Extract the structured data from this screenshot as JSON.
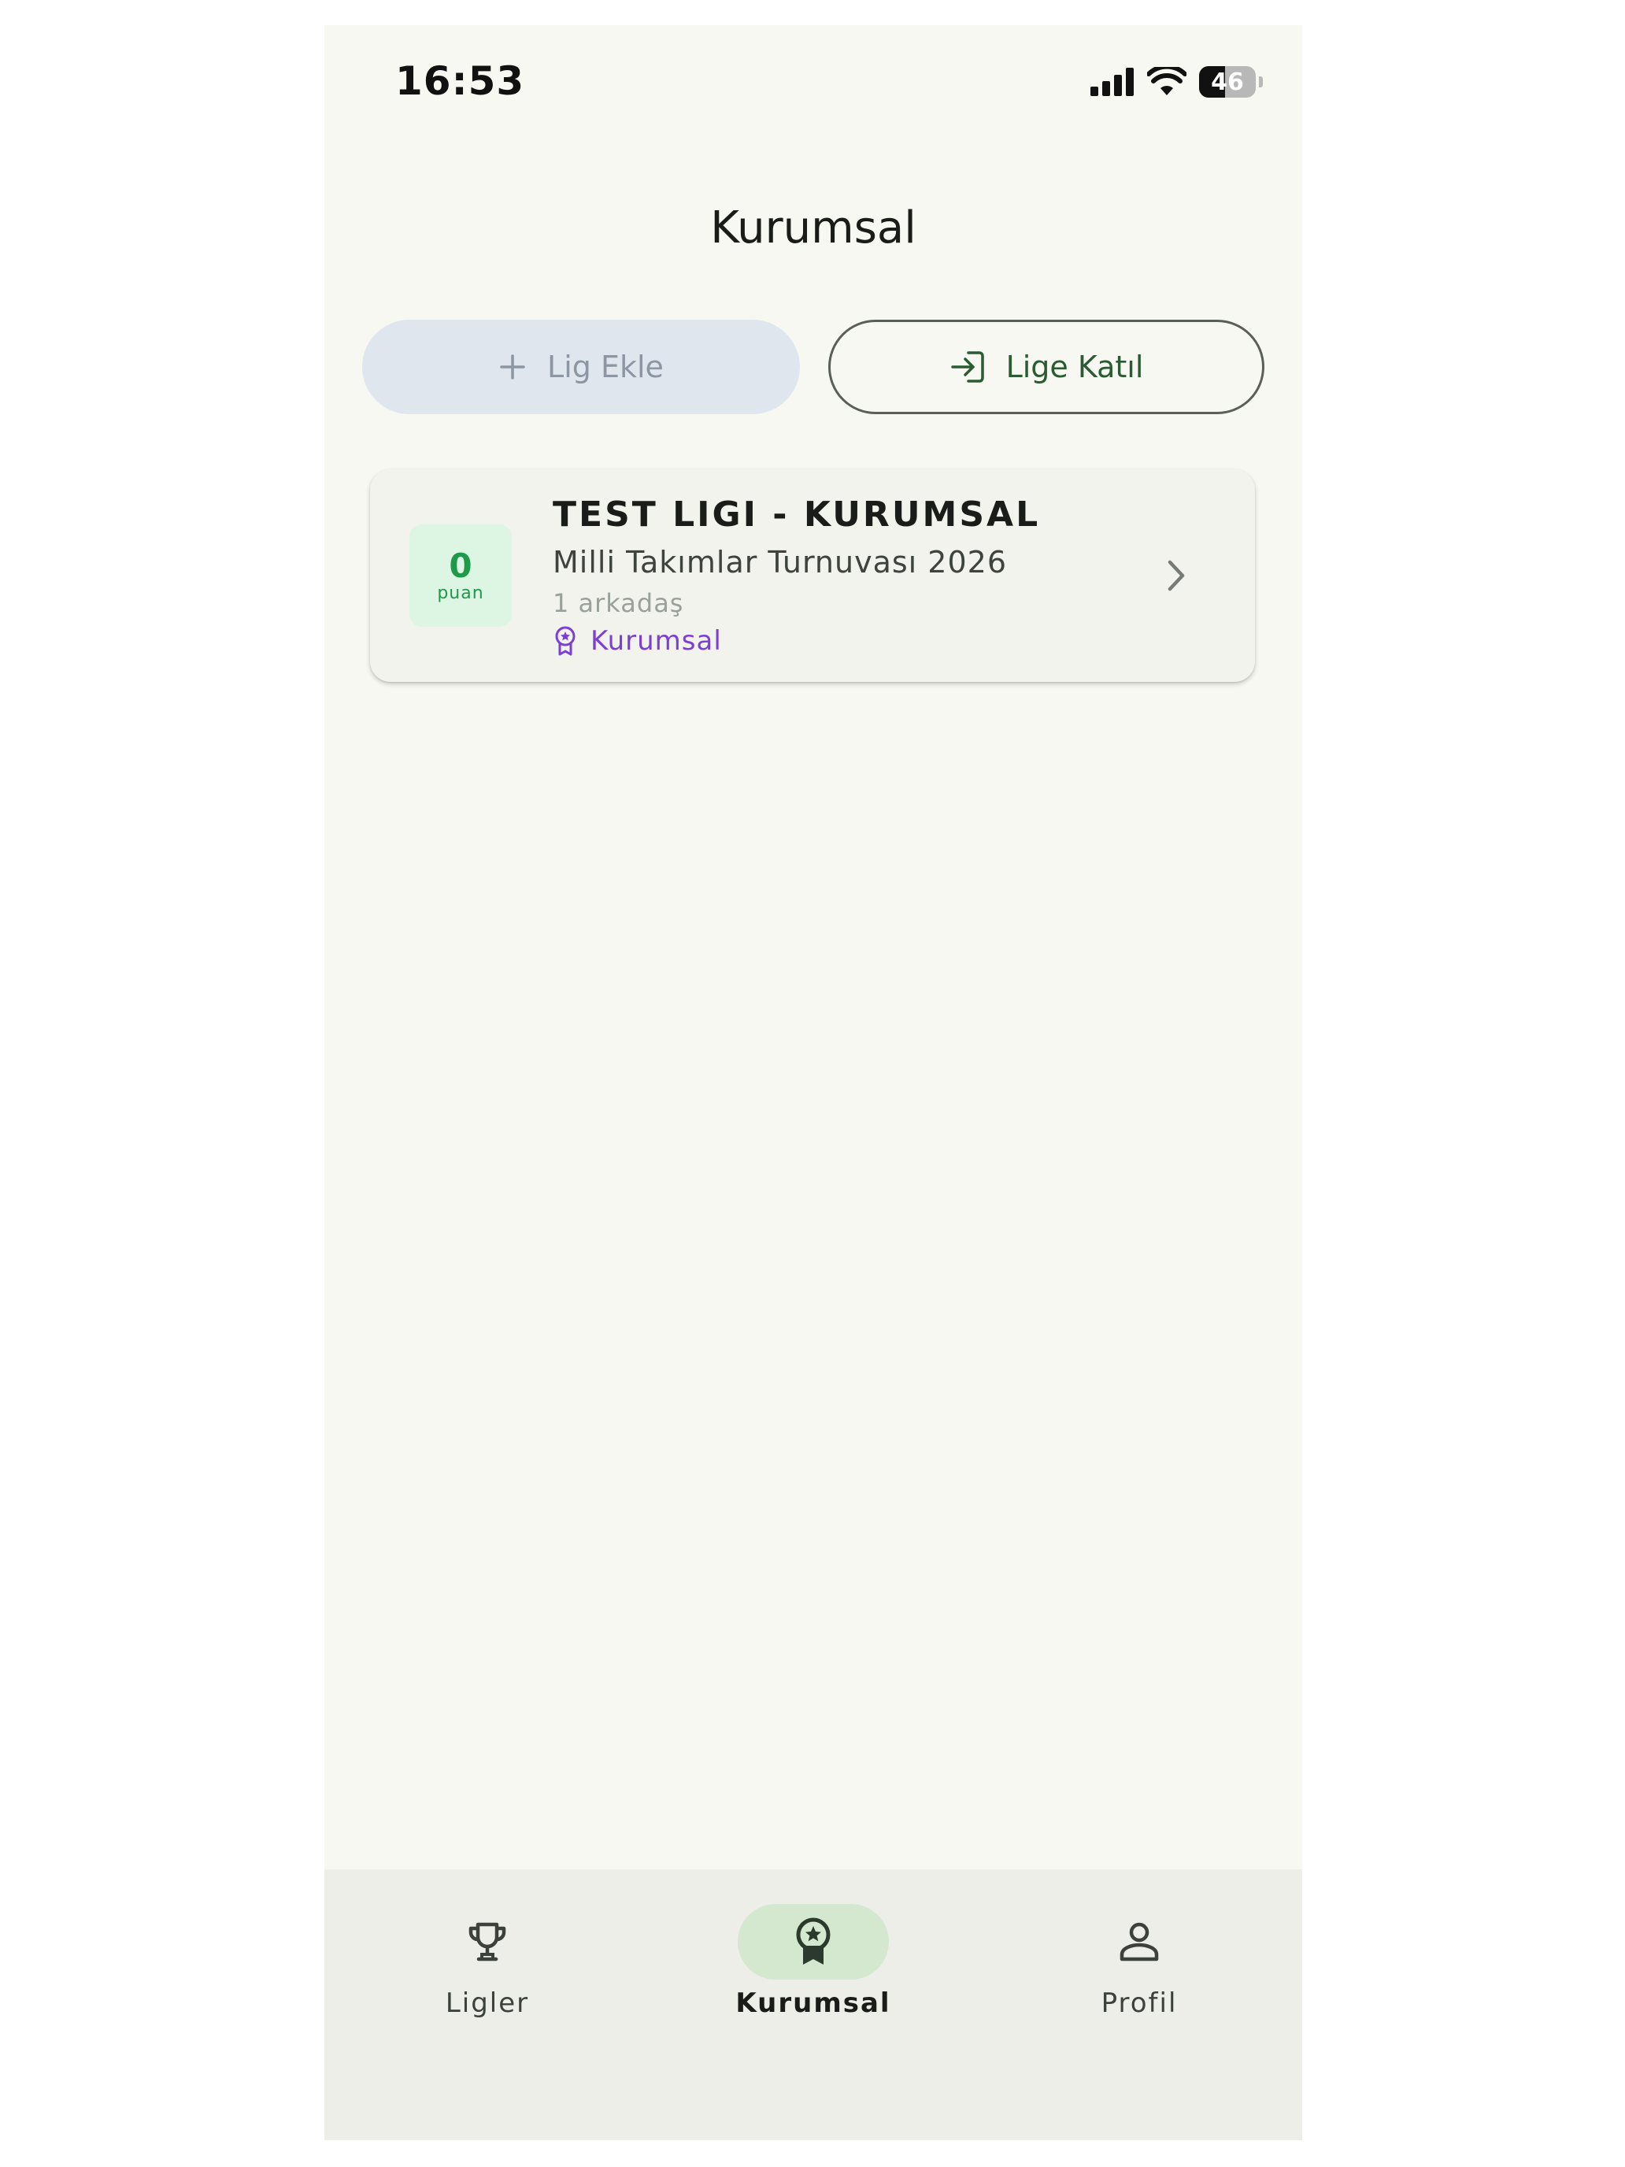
{
  "status_bar": {
    "time": "16:53",
    "battery_level": "46",
    "battery_fraction": 0.46,
    "icons": [
      "cellular-signal-icon",
      "wifi-icon",
      "battery-icon"
    ]
  },
  "header": {
    "title": "Kurumsal"
  },
  "actions": {
    "add_league_label": "Lig Ekle",
    "add_league_icon": "plus-icon",
    "join_league_label": "Lige Katıl",
    "join_league_icon": "login-arrow-icon"
  },
  "leagues": [
    {
      "name": "TEST LIGI - KURUMSAL",
      "tournament": "Milli Takımlar Turnuvası 2026",
      "members": "1 arkadaş",
      "type_label": "Kurumsal",
      "type_icon": "award-badge-icon",
      "points_value": "0",
      "points_label": "puan"
    }
  ],
  "bottom_nav": {
    "items": [
      {
        "label": "Ligler",
        "icon": "trophy-icon",
        "active": false
      },
      {
        "label": "Kurumsal",
        "icon": "award-badge-icon",
        "active": true
      },
      {
        "label": "Profil",
        "icon": "person-icon",
        "active": false
      }
    ]
  },
  "colors": {
    "background": "#f6f8f1",
    "accent_green": "#2a5b32",
    "points_green": "#1f9a4a",
    "corporate_purple": "#7c3fd6",
    "nav_active_pill": "#d3e8cf"
  }
}
